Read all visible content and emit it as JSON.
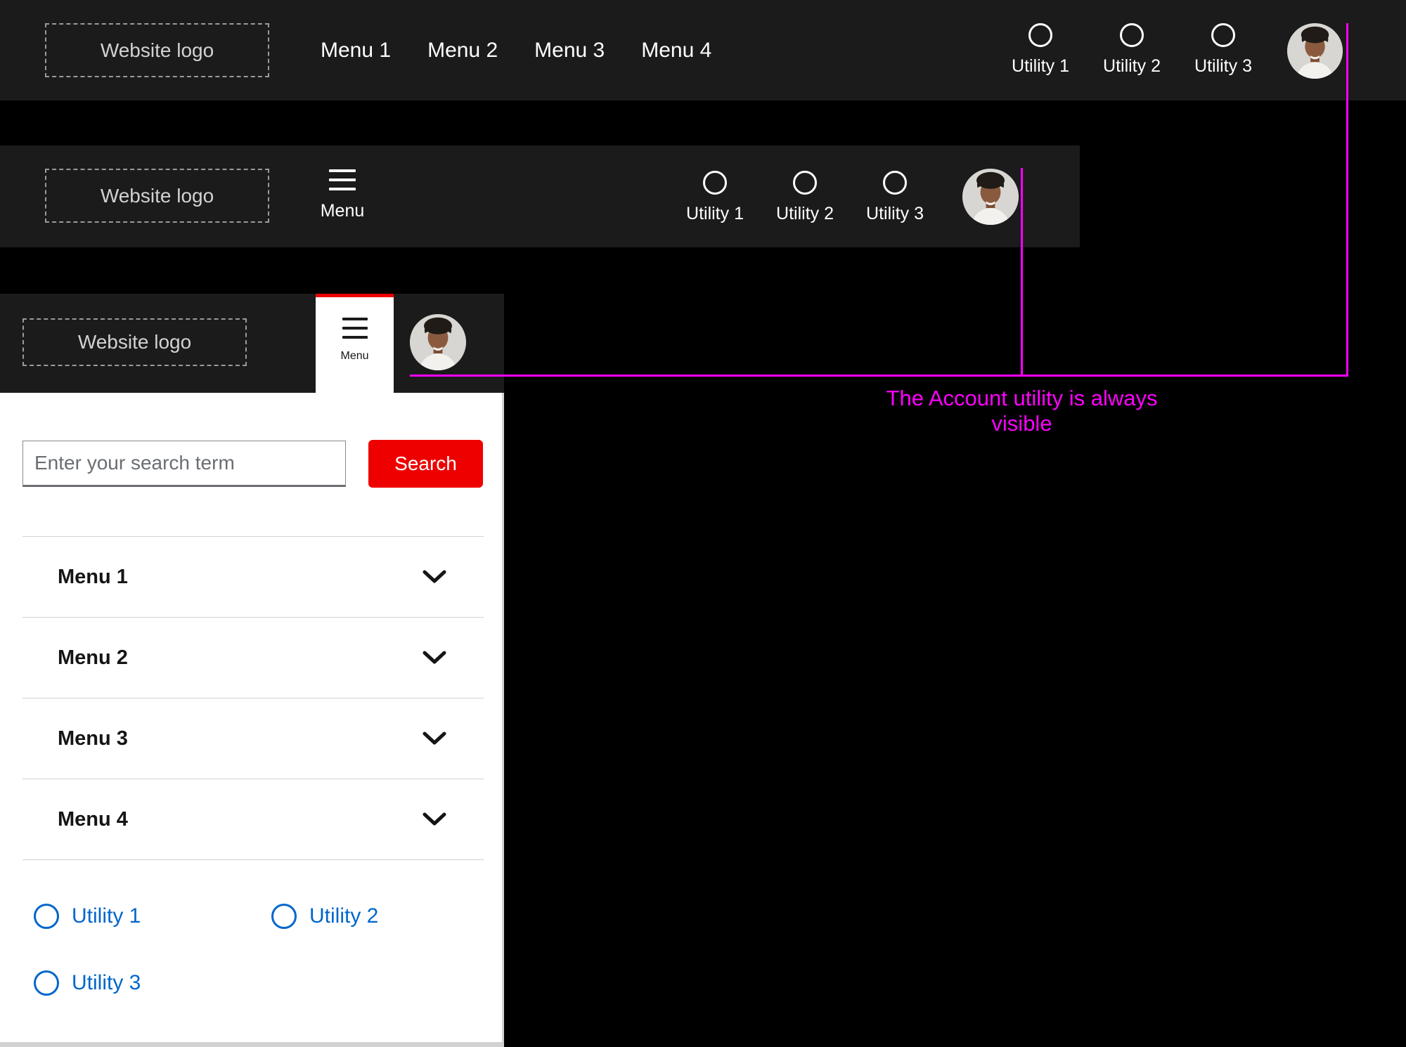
{
  "colors": {
    "header_bg": "#1b1b1b",
    "accent_red": "#ee0000",
    "link_blue": "#0066cc",
    "annotation_magenta": "#ff00ff"
  },
  "desktop_header": {
    "logo_label": "Website logo",
    "menu_items": [
      "Menu 1",
      "Menu 2",
      "Menu 3",
      "Menu 4"
    ],
    "utilities": [
      "Utility 1",
      "Utility 2",
      "Utility 3"
    ]
  },
  "tablet_header": {
    "logo_label": "Website logo",
    "menu_button_label": "Menu",
    "utilities": [
      "Utility 1",
      "Utility 2",
      "Utility 3"
    ]
  },
  "mobile_header": {
    "logo_label": "Website logo",
    "menu_button_label": "Menu"
  },
  "mobile_menu": {
    "search_placeholder": "Enter your search term",
    "search_button_label": "Search",
    "menu_items": [
      "Menu 1",
      "Menu 2",
      "Menu 3",
      "Menu 4"
    ],
    "utilities": [
      "Utility 1",
      "Utility 2",
      "Utility 3"
    ]
  },
  "annotation": {
    "label": "The Account utility is always visible"
  }
}
